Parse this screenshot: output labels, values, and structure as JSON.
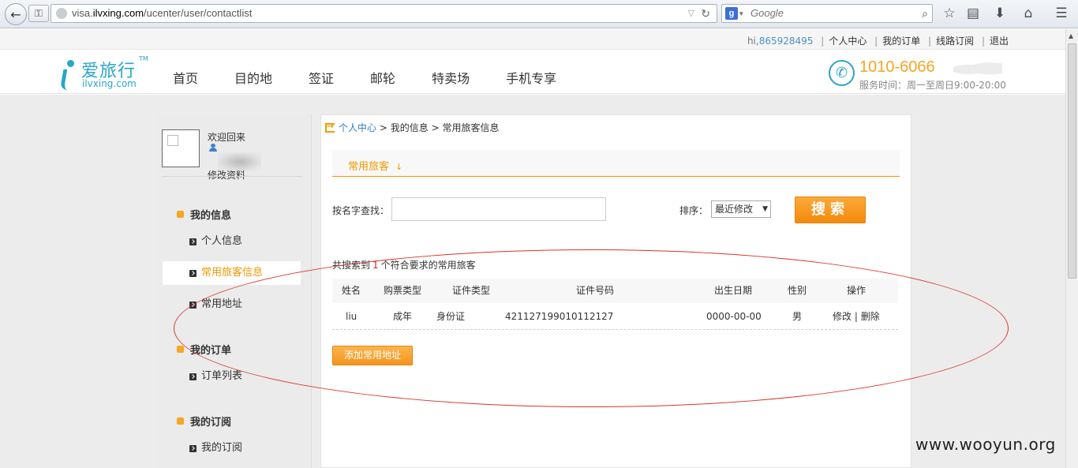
{
  "browser": {
    "url_prefix": "visa.",
    "url_domain": "ilvxing.com",
    "url_path": "/ucenter/user/contactlist",
    "search_placeholder": "Google"
  },
  "toplinks": {
    "hi": "hi,",
    "user_id": "865928495",
    "items": [
      "个人中心",
      "我的订单",
      "线路订阅",
      "退出"
    ]
  },
  "header": {
    "logo_cn": "爱旅行",
    "logo_tm": "TM",
    "logo_en": "ilvxing.com",
    "nav": [
      "首页",
      "目的地",
      "签证",
      "邮轮",
      "特卖场",
      "手机专享"
    ],
    "phone": "1010-6066",
    "service_hours": "服务时间：周一至周日9:00-20:00"
  },
  "sidebar": {
    "welcome": "欢迎回来",
    "edit_profile": "修改资料",
    "sections": [
      {
        "title": "我的信息",
        "items": [
          "个人信息",
          "常用旅客信息",
          "常用地址"
        ]
      },
      {
        "title": "我的订单",
        "items": [
          "订单列表"
        ]
      },
      {
        "title": "我的订阅",
        "items": [
          "我的订阅"
        ]
      }
    ]
  },
  "main": {
    "breadcrumb": {
      "root": "个人中心",
      "sep": ">",
      "level2": "我的信息",
      "level3": "常用旅客信息"
    },
    "tab": "常用旅客",
    "search_label": "按名字查找：",
    "name_input_value": "",
    "sort_label": "排序：",
    "sort_value": "最近修改",
    "search_button": "搜索",
    "result_prefix": "共搜索到",
    "result_count": "1",
    "result_suffix": "个符合要求的常用旅客",
    "columns": [
      "姓名",
      "购票类型",
      "证件类型",
      "证件号码",
      "出生日期",
      "性别",
      "操作"
    ],
    "rows": [
      {
        "name": "liu",
        "ticket_type": "成年",
        "id_type": "身份证",
        "id_number": "421127199010112127",
        "birth_date": "0000-00-00",
        "gender": "男",
        "edit": "修改",
        "action_sep": "|",
        "delete": "删除"
      }
    ],
    "add_button": "添加常用地址"
  },
  "watermark": "www.wooyun.org",
  "colors": {
    "brand": "#27a6c8",
    "accent": "#f39800",
    "link": "#2a7fc0",
    "annotation": "#d9342b"
  }
}
